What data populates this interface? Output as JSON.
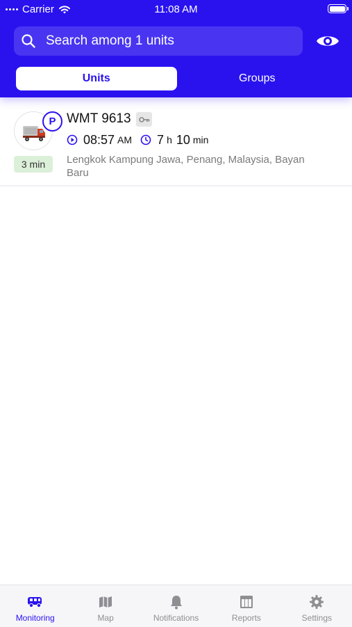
{
  "status_bar": {
    "carrier": "Carrier",
    "time": "11:08 AM"
  },
  "search": {
    "placeholder": "Search among 1 units"
  },
  "tabs": [
    {
      "label": "Units",
      "active": true
    },
    {
      "label": "Groups",
      "active": false
    }
  ],
  "unit": {
    "name": "WMT 9613",
    "state_badge": "P",
    "duration": "3 min",
    "time": "08:57",
    "time_suffix": "AM",
    "hours": "7",
    "hours_unit": "h",
    "minutes": "10",
    "minutes_unit": "min",
    "address": "Lengkok Kampung Jawa, Penang, Malaysia, Bayan Baru"
  },
  "tabbar": [
    {
      "label": "Monitoring",
      "icon": "truck-icon",
      "active": true
    },
    {
      "label": "Map",
      "icon": "map-icon",
      "active": false
    },
    {
      "label": "Notifications",
      "icon": "bell-icon",
      "active": false
    },
    {
      "label": "Reports",
      "icon": "table-icon",
      "active": false
    },
    {
      "label": "Settings",
      "icon": "gear-icon",
      "active": false
    }
  ],
  "colors": {
    "accent": "#2a12ef",
    "badge_bg": "#dcefd9",
    "header_bg": "#2a12ef"
  }
}
